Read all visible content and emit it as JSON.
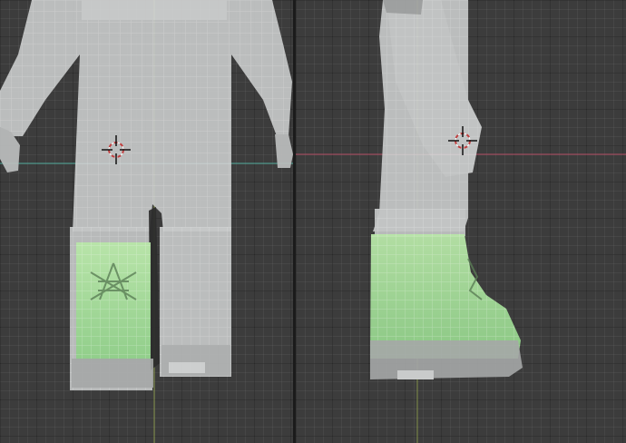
{
  "window": {
    "label": ""
  },
  "viewports": [
    {
      "view": "front"
    },
    {
      "view": "side"
    }
  ],
  "colors": {
    "background": "#3c3c3c",
    "mesh_fill": "#c9cbcb",
    "mesh_wire": "#ffffff",
    "selected_fill": "#8fd58a",
    "axis_x": "#c0546b",
    "axis_y": "#5fb39c",
    "axis_z": "#8fa84e",
    "divider": "#1b1b1b"
  },
  "icons": {
    "cursor": "3d-cursor-icon"
  }
}
